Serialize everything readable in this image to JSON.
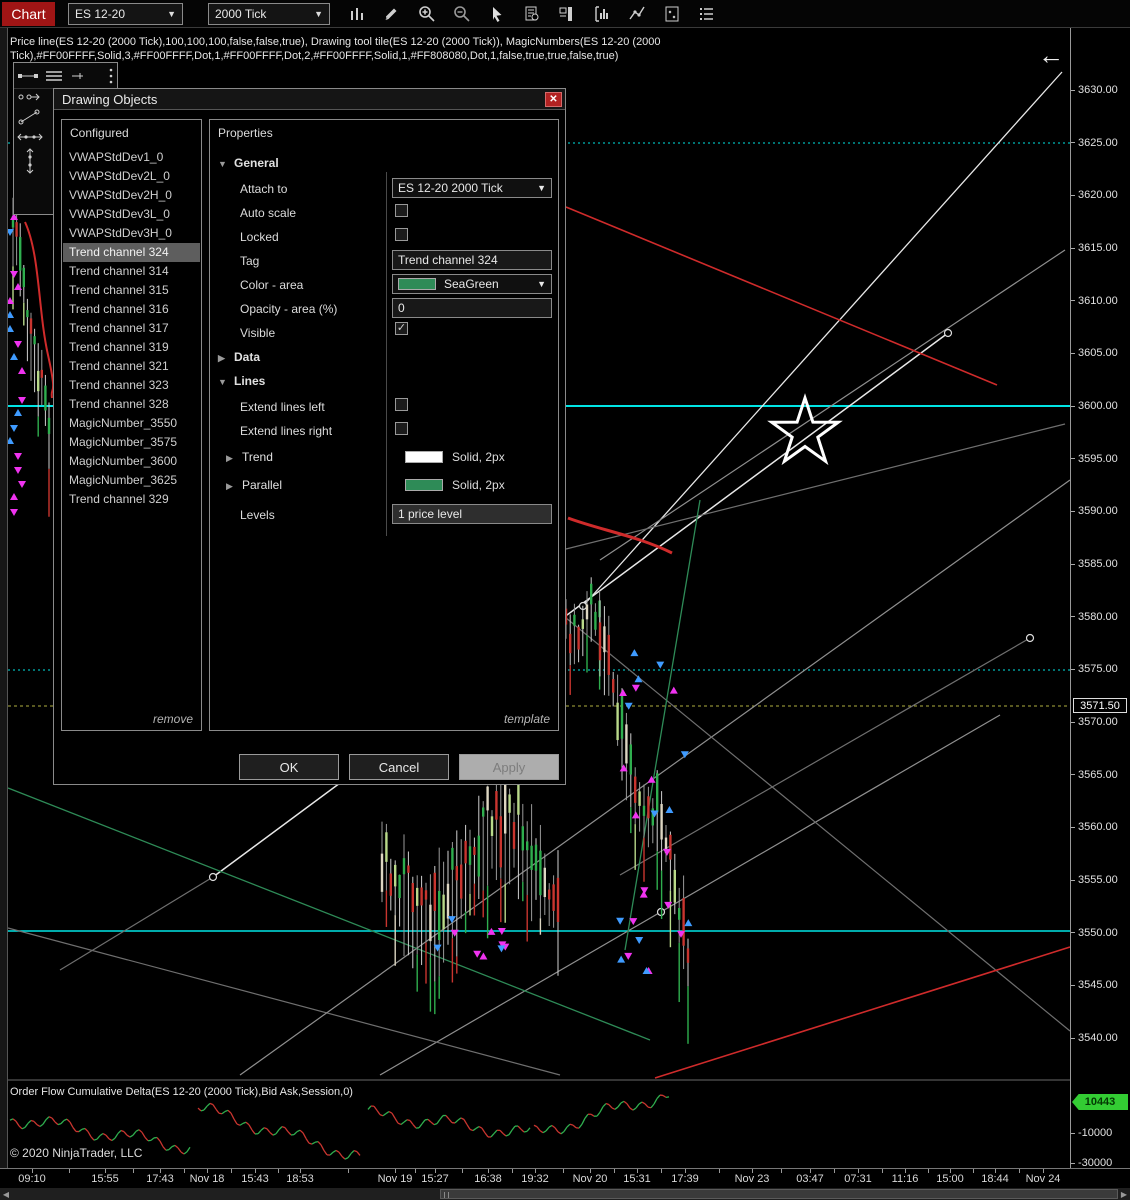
{
  "toolbar": {
    "chart_button": "Chart",
    "instrument": "ES 12-20",
    "interval": "2000 Tick"
  },
  "chart_header": {
    "indicator_line": "Price line(ES 12-20 (2000 Tick),100,100,100,false,false,true), Drawing tool tile(ES 12-20 (2000 Tick)), MagicNumbers(ES 12-20 (2000 Tick),#FF00FFFF,Solid,3,#FF00FFFF,Dot,1,#FF00FFFF,Dot,2,#FF00FFFF,Solid,1,#FF808080,Dot,1,false,true,true,false,true)",
    "back_arrow": "←"
  },
  "dialog": {
    "title": "Drawing Objects",
    "configured_header": "Configured",
    "configured_items": [
      "VWAPStdDev1_0",
      "VWAPStdDev2L_0",
      "VWAPStdDev2H_0",
      "VWAPStdDev3L_0",
      "VWAPStdDev3H_0",
      "Trend channel 324",
      "Trend channel 314",
      "Trend channel 315",
      "Trend channel 316",
      "Trend channel 317",
      "Trend channel 319",
      "Trend channel 321",
      "Trend channel 323",
      "Trend channel 328",
      "MagicNumber_3550",
      "MagicNumber_3575",
      "MagicNumber_3600",
      "MagicNumber_3625",
      "Trend channel 329"
    ],
    "selected_index": 5,
    "remove_link": "remove",
    "properties_header": "Properties",
    "general": {
      "header": "General",
      "attach_label": "Attach to",
      "attach_value": "ES 12-20 2000 Tick",
      "autoscale_label": "Auto scale",
      "locked_label": "Locked",
      "tag_label": "Tag",
      "tag_value": "Trend channel 324",
      "color_label": "Color - area",
      "color_value": "SeaGreen",
      "opacity_label": "Opacity - area (%)",
      "opacity_value": "0",
      "visible_label": "Visible",
      "visible_check": "✓"
    },
    "data_header": "Data",
    "lines": {
      "header": "Lines",
      "extend_left_label": "Extend lines left",
      "extend_right_label": "Extend lines right",
      "trend_label": "Trend",
      "trend_value": "Solid, 2px",
      "parallel_label": "Parallel",
      "parallel_value": "Solid, 2px",
      "levels_label": "Levels",
      "levels_value": "1 price level"
    },
    "template_link": "template",
    "ok": "OK",
    "cancel": "Cancel",
    "apply": "Apply"
  },
  "price_axis": {
    "ticks": [
      "3630.00",
      "3625.00",
      "3620.00",
      "3615.00",
      "3610.00",
      "3605.00",
      "3600.00",
      "3595.00",
      "3590.00",
      "3585.00",
      "3580.00",
      "3575.00",
      "3570.00",
      "3565.00",
      "3560.00",
      "3555.00",
      "3550.00",
      "3545.00",
      "3540.00"
    ],
    "current_price": "3571.50"
  },
  "delta_panel": {
    "title": "Order Flow Cumulative Delta(ES 12-20 (2000 Tick),Bid Ask,Session,0)",
    "copyright": "© 2020 NinjaTrader, LLC",
    "current_value": "10443",
    "ticks": [
      "-10000",
      "-30000"
    ]
  },
  "time_axis": {
    "labels": [
      "09:10",
      "15:55",
      "17:43",
      "Nov 18",
      "15:43",
      "18:53",
      "Nov 19",
      "15:27",
      "16:38",
      "19:32",
      "Nov 20",
      "15:31",
      "17:39",
      "Nov 23",
      "03:47",
      "07:31",
      "11:16",
      "15:00",
      "18:44",
      "Nov 24"
    ]
  },
  "colors": {
    "seagreen": "#2E8B57",
    "cyan": "#00E5E5",
    "badge_green": "#33CC33",
    "chart_red": "#A01515"
  }
}
